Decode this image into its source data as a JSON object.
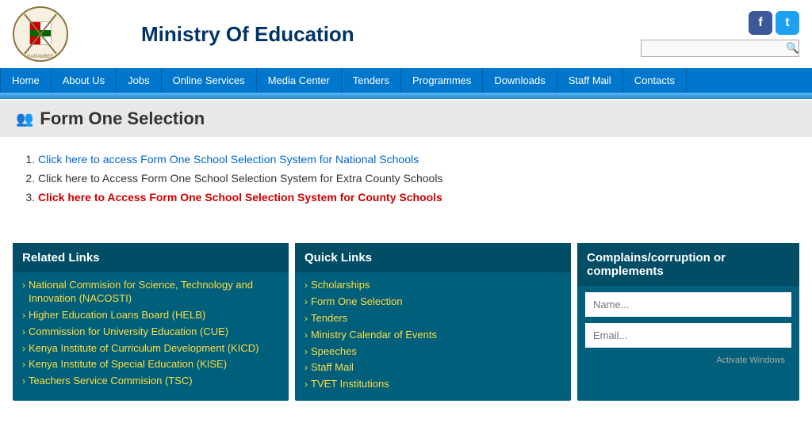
{
  "header": {
    "title": "Ministry Of Education",
    "logo_alt": "Kenya Government Crest"
  },
  "social": {
    "facebook_label": "f",
    "twitter_label": "t"
  },
  "search": {
    "placeholder": ""
  },
  "nav": {
    "items": [
      {
        "label": "Home",
        "id": "home"
      },
      {
        "label": "About Us",
        "id": "about-us"
      },
      {
        "label": "Jobs",
        "id": "jobs"
      },
      {
        "label": "Online Services",
        "id": "online-services"
      },
      {
        "label": "Media Center",
        "id": "media-center"
      },
      {
        "label": "Tenders",
        "id": "tenders"
      },
      {
        "label": "Programmes",
        "id": "programmes"
      },
      {
        "label": "Downloads",
        "id": "downloads"
      },
      {
        "label": "Staff Mail",
        "id": "staff-mail"
      },
      {
        "label": "Contacts",
        "id": "contacts"
      }
    ]
  },
  "page": {
    "title": "Form One Selection",
    "icon": "🔗"
  },
  "selection_items": [
    {
      "id": 1,
      "text": "Click here to access Form One School Selection System for National Schools",
      "link_type": "blue"
    },
    {
      "id": 2,
      "text": "Click here to Access Form One School Selection System for Extra County Schools",
      "link_type": "black"
    },
    {
      "id": 3,
      "text": "Click here to Access Form One School Selection System for County Schools",
      "link_type": "red"
    }
  ],
  "related_links": {
    "header": "Related Links",
    "items": [
      "National Commision for Science, Technology and Innovation (NACOSTI)",
      "Higher Education Loans Board (HELB)",
      "Commission for University Education (CUE)",
      "Kenya Institute of Curriculum Development (KICD)",
      "Kenya Institute of Special Education (KISE)",
      "Teachers Service Commision (TSC)"
    ]
  },
  "quick_links": {
    "header": "Quick Links",
    "items": [
      "Scholarships",
      "Form One Selection",
      "Tenders",
      "Ministry Calendar of Events",
      "Speeches",
      "Staff Mail",
      "TVET Institutions"
    ]
  },
  "complaints": {
    "header": "Complains/corruption or complements",
    "name_placeholder": "Name...",
    "email_placeholder": "Email...",
    "activate_windows": "Activate Windows"
  }
}
